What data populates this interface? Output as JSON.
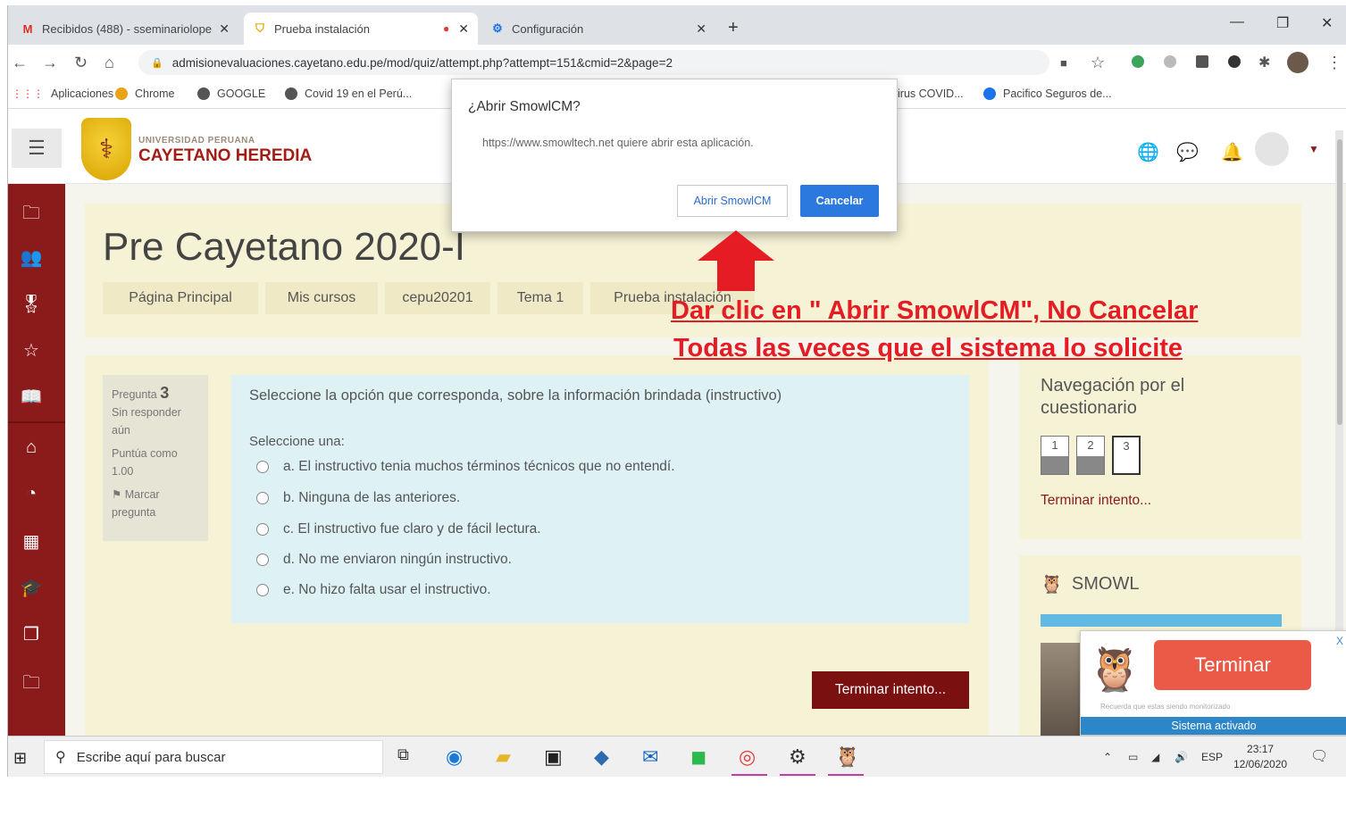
{
  "browser": {
    "tabs": [
      {
        "label": "Recibidos (488) - sseminariolope"
      },
      {
        "label": "Prueba instalación"
      },
      {
        "label": "Configuración"
      }
    ],
    "url": "admisionevaluaciones.cayetano.edu.pe/mod/quiz/attempt.php?attempt=151&cmid=2&page=2",
    "bookmarks": [
      "Aplicaciones",
      "Chrome",
      "GOOGLE",
      "Covid 19 en el Perú...",
      "irus COVID...",
      "Pacifico Seguros de..."
    ]
  },
  "site": {
    "university_small": "UNIVERSIDAD PERUANA",
    "university_name": "CAYETANO HEREDIA",
    "course_title": "Pre Cayetano 2020-I",
    "breadcrumb": [
      "Página Principal",
      "Mis cursos",
      "cepu20201",
      "Tema 1",
      "Prueba instalación"
    ]
  },
  "question": {
    "label": "Pregunta",
    "number": "3",
    "status_line1": "Sin responder",
    "status_line2": "aún",
    "score_line1": "Puntúa como",
    "score_line2": "1.00",
    "flag_line1": "Marcar",
    "flag_line2": "pregunta",
    "text": "Seleccione la opción que corresponda, sobre la información brindada (instructivo)",
    "prompt": "Seleccione una:",
    "options": [
      "a. El instructivo tenia muchos términos técnicos que no entendí.",
      "b. Ninguna de las anteriores.",
      "c. El instructivo fue claro y de fácil lectura.",
      "d. No me enviaron ningún instructivo.",
      "e. No hizo falta usar el instructivo."
    ],
    "finish_button": "Terminar intento..."
  },
  "quiz_nav": {
    "title": "Navegación por el cuestionario",
    "questions": [
      "1",
      "2",
      "3"
    ],
    "finish_link": "Terminar intento..."
  },
  "smowl": {
    "block_title": "SMOWL",
    "popup_button": "Terminar",
    "popup_note": "Recuerda que estas siendo monitorizado",
    "popup_status": "Sistema activado",
    "popup_close": "X"
  },
  "dialog": {
    "title": "¿Abrir SmowlCM?",
    "message": "https://www.smowltech.net quiere abrir esta aplicación.",
    "open_button": "Abrir SmowlCM",
    "cancel_button": "Cancelar"
  },
  "annotation": {
    "line1": "Dar clic en \" Abrir SmowlCM\", No Cancelar",
    "line2": "Todas las veces que el sistema lo solicite"
  },
  "taskbar": {
    "search_placeholder": "Escribe aquí para buscar",
    "language": "ESP",
    "time": "23:17",
    "date": "12/06/2020"
  },
  "colors": {
    "brand_red": "#8b1a1a",
    "annotation_red": "#e51c23",
    "dialog_blue": "#2b79de"
  }
}
